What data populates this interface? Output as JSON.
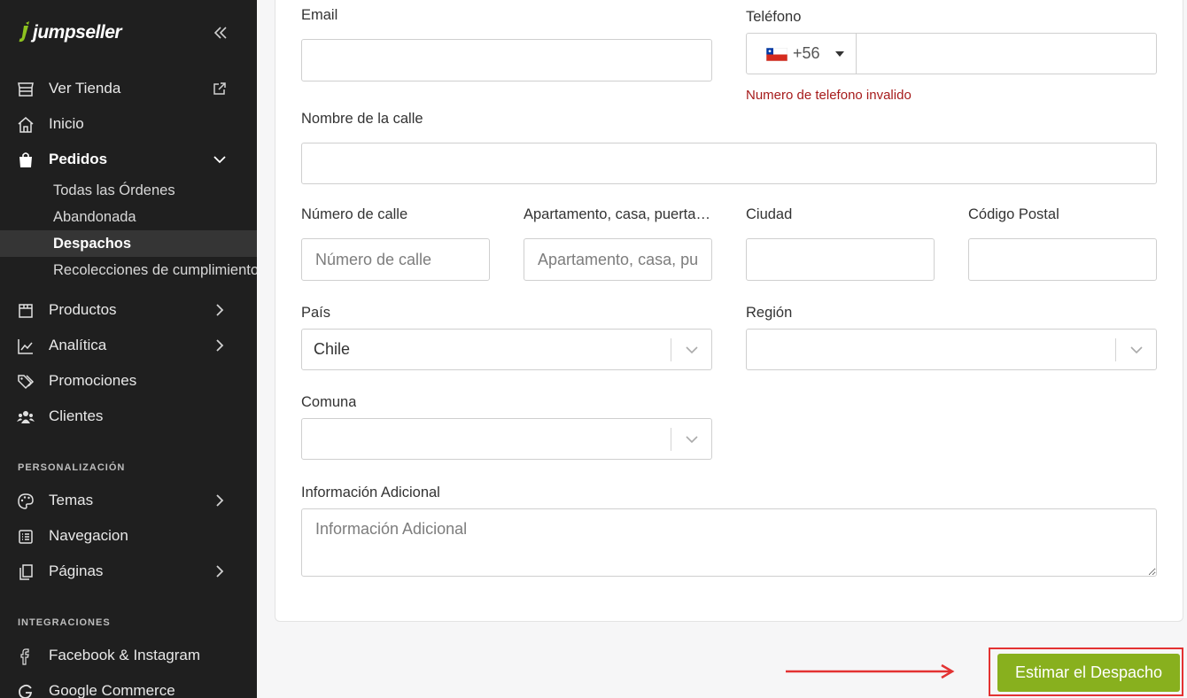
{
  "brand": {
    "name": "jumpseller"
  },
  "sidebar": {
    "items": [
      {
        "label": "Ver Tienda",
        "icon": "store-icon"
      },
      {
        "label": "Inicio",
        "icon": "home-icon"
      },
      {
        "label": "Pedidos",
        "icon": "shopping-bag-icon"
      },
      {
        "label": "Productos",
        "icon": "box-icon"
      },
      {
        "label": "Analítica",
        "icon": "chart-line-icon"
      },
      {
        "label": "Promociones",
        "icon": "tags-icon"
      },
      {
        "label": "Clientes",
        "icon": "users-icon"
      },
      {
        "label": "Temas",
        "icon": "palette-icon"
      },
      {
        "label": "Navegacion",
        "icon": "list-icon"
      },
      {
        "label": "Páginas",
        "icon": "pages-icon"
      },
      {
        "label": "Facebook & Instagram",
        "icon": "facebook-icon"
      },
      {
        "label": "Google Commerce",
        "icon": "google-icon"
      }
    ],
    "pedidos_sub": [
      {
        "label": "Todas las Órdenes"
      },
      {
        "label": "Abandonada"
      },
      {
        "label": "Despachos",
        "active": true
      },
      {
        "label": "Recolecciones de cumplimiento"
      }
    ],
    "sections": {
      "personalizacion": "PERSONALIZACIÓN",
      "integraciones": "INTEGRACIONES"
    }
  },
  "form": {
    "email_label": "Email",
    "email_value": "",
    "phone_label": "Teléfono",
    "phone_country_code": "+56",
    "phone_value": "",
    "phone_error": "Numero de telefono invalido",
    "street_label": "Nombre de la calle",
    "street_value": "",
    "street_number_label": "Número de calle",
    "street_number_placeholder": "Número de calle",
    "apartment_label": "Apartamento, casa, puerta, etc.",
    "apartment_placeholder": "Apartamento, casa, puerta, etc.",
    "city_label": "Ciudad",
    "postal_label": "Código Postal",
    "country_label": "País",
    "country_value": "Chile",
    "region_label": "Región",
    "region_value": "",
    "comuna_label": "Comuna",
    "comuna_value": "",
    "additional_label": "Información Adicional",
    "additional_placeholder": "Información Adicional"
  },
  "actions": {
    "estimate_label": "Estimar el Despacho"
  },
  "colors": {
    "sidebar_bg": "#1f1f1f",
    "accent_green": "#88b01e",
    "error_red": "#a61b1b",
    "highlight_red": "#e33232",
    "brand_green": "#8dc21f"
  }
}
